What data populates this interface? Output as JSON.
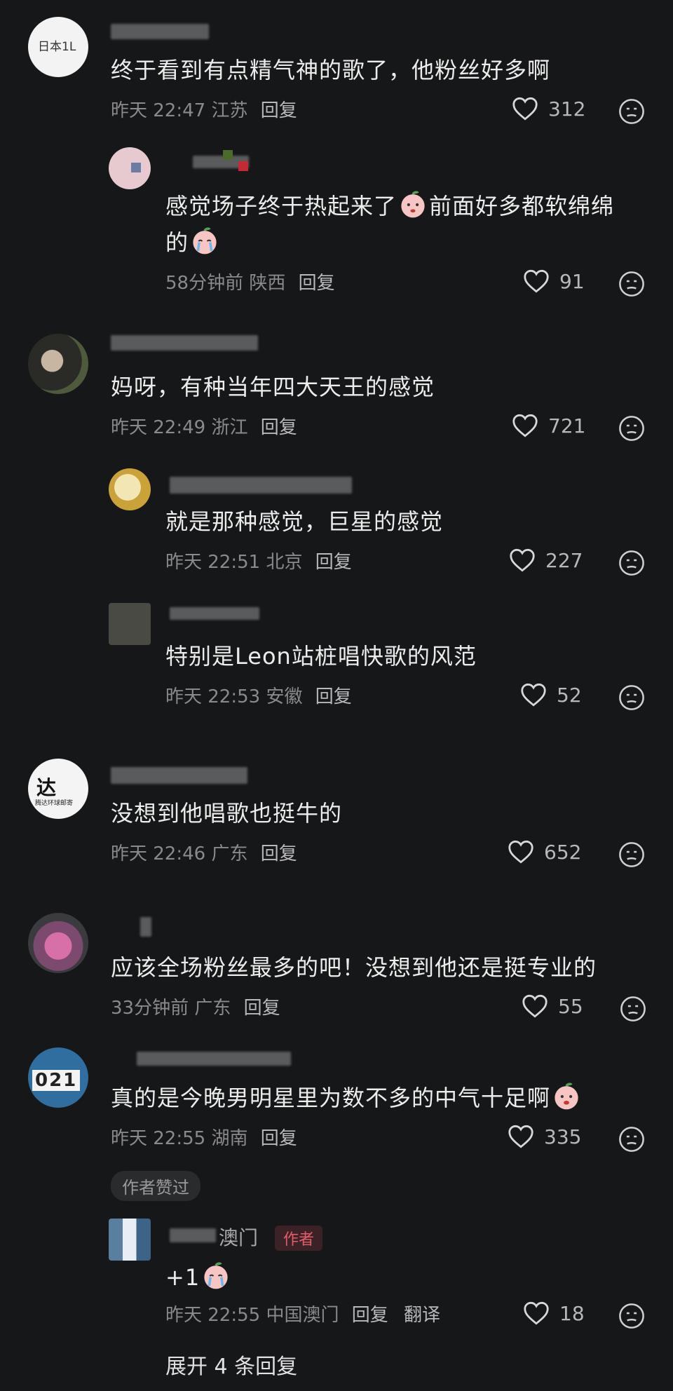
{
  "comments": [
    {
      "text": "终于看到有点精气神的歌了，他粉丝好多啊",
      "time": "昨天 22:47",
      "location": "江苏",
      "reply": "回复",
      "likes": "312"
    },
    {
      "text_a": "感觉场子终于热起来了",
      "text_b": "前面好多都软绵绵",
      "text_c": "的",
      "time": "58分钟前",
      "location": "陕西",
      "reply": "回复",
      "likes": "91"
    },
    {
      "text": "妈呀，有种当年四大天王的感觉",
      "time": "昨天 22:49",
      "location": "浙江",
      "reply": "回复",
      "likes": "721"
    },
    {
      "text": "就是那种感觉，巨星的感觉",
      "time": "昨天 22:51",
      "location": "北京",
      "reply": "回复",
      "likes": "227"
    },
    {
      "text": "特别是Leon站桩唱快歌的风范",
      "time": "昨天 22:53",
      "location": "安徽",
      "reply": "回复",
      "likes": "52"
    },
    {
      "text": "没想到他唱歌也挺牛的",
      "time": "昨天 22:46",
      "location": "广东",
      "reply": "回复",
      "likes": "652"
    },
    {
      "text": "应该全场粉丝最多的吧！没想到他还是挺专业的",
      "time": "33分钟前",
      "location": "广东",
      "reply": "回复",
      "likes": "55"
    },
    {
      "text": "真的是今晚男明星里为数不多的中气十足啊",
      "time": "昨天 22:55",
      "location": "湖南",
      "reply": "回复",
      "likes": "335",
      "badge": "作者赞过"
    },
    {
      "name_suffix": "澳门",
      "author_tag": "作者",
      "text": "+1",
      "time": "昨天 22:55",
      "location": "中国澳门",
      "reply": "回复",
      "translate": "翻译",
      "likes": "18"
    }
  ],
  "avatars": {
    "a1_label": "日本1L",
    "a6_label": "达",
    "a6_sub": "腾达环球邮寄",
    "a8_label": "021"
  },
  "expand": "展开 4 条回复",
  "icons": {
    "like": "heart-outline-icon",
    "dislike": "meh-face-icon"
  }
}
